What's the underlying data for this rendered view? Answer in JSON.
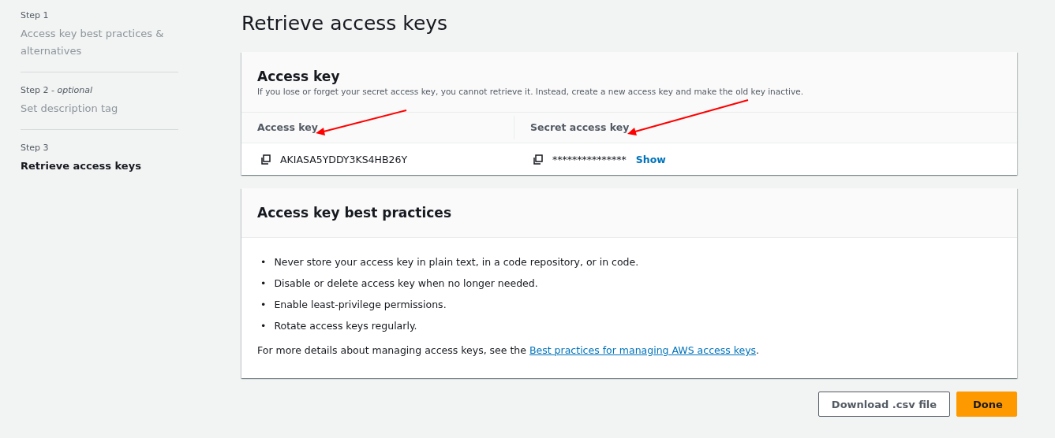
{
  "steps": [
    {
      "label": "Step 1",
      "title": "Access key best practices & alternatives",
      "selected": false
    },
    {
      "label": "Step 2 - *optional*",
      "title": "Set description tag",
      "selected": false
    },
    {
      "label": "Step 3",
      "title": "Retrieve access keys",
      "selected": true
    }
  ],
  "page_title": "Retrieve access keys",
  "access_key_card": {
    "title": "Access key",
    "description": "If you lose or forget your secret access key, you cannot retrieve it. Instead, create a new access key and make the old key inactive.",
    "columns": [
      "Access key",
      "Secret access key"
    ],
    "access_key": "AKIASA5YDDY3KS4HB26Y",
    "secret_masked": "***************",
    "show_link": "Show"
  },
  "best_practices_card": {
    "title": "Access key best practices",
    "items": [
      {
        "bullet": "•",
        "text": "Never store your access key in plain text, in a code repository, or in code."
      },
      {
        "bullet": "•",
        "text": "Disable or delete access key when no longer needed."
      },
      {
        "bullet": "•",
        "text": "Enable least-privilege permissions."
      },
      {
        "bullet": "•",
        "text": "Rotate access keys regularly."
      }
    ],
    "footer_text": "For more details about managing access keys, see the ",
    "footer_link": "Best practices for managing AWS access keys",
    "footer_end": "."
  },
  "buttons": [
    {
      "label": "Download .csv file",
      "kind": "secondary"
    },
    {
      "label": "Done",
      "kind": "primary"
    }
  ]
}
